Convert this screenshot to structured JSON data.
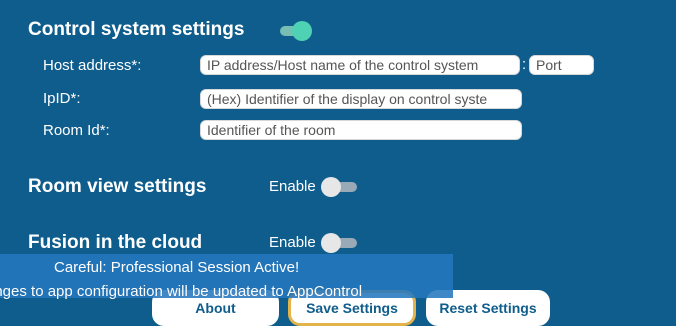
{
  "control_system": {
    "title": "Control system settings",
    "toggle_on": true,
    "host_label": "Host address*:",
    "host_placeholder": "IP address/Host name of the control system",
    "separator": ":",
    "port_placeholder": "Port",
    "ipid_label": "IpID*:",
    "ipid_placeholder": "(Hex) Identifier of the display on control syste",
    "room_label": "Room Id*:",
    "room_placeholder": "Identifier of the room"
  },
  "room_view": {
    "title": "Room view settings",
    "enable_label": "Enable",
    "toggle_on": false
  },
  "fusion": {
    "title": "Fusion in the cloud",
    "enable_label": "Enable",
    "toggle_on": false
  },
  "buttons": {
    "about": "About",
    "save": "Save Settings",
    "reset": "Reset Settings"
  },
  "toast": {
    "line1": "Careful: Professional Session Active!",
    "line2": "anges to app configuration will be updated to AppControl"
  },
  "colors": {
    "background": "#0f5d8d",
    "accent_toggle": "#4fd1b4",
    "focus_border": "#e3b44c"
  }
}
